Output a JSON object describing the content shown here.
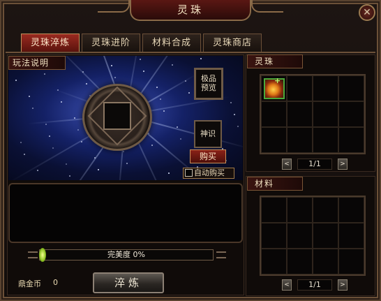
{
  "window": {
    "title": "灵珠",
    "close_label": "✕"
  },
  "tabs": [
    {
      "label": "灵珠淬炼",
      "active": true
    },
    {
      "label": "灵珠进阶",
      "active": false
    },
    {
      "label": "材料合成",
      "active": false
    },
    {
      "label": "灵珠商店",
      "active": false
    }
  ],
  "left": {
    "howto_label": "玩法说明",
    "premium_preview_line1": "极品",
    "premium_preview_line2": "预览",
    "shenshi_label": "神识",
    "buy_label": "购买",
    "autobuy_label": "自动购买",
    "autobuy_checked": false,
    "progress_text": "完美度 0%",
    "progress_value": 0,
    "gold_label": "鼎金币",
    "gold_value": "0",
    "refine_label": "淬炼"
  },
  "right": {
    "orb_label": "灵珠",
    "orb_items": [
      {
        "slot": 0,
        "icon": "fire-orb-icon",
        "badge": "+"
      }
    ],
    "orb_pager": {
      "text": "1/1",
      "prev": "<",
      "next": ">"
    },
    "material_label": "材料",
    "material_pager": {
      "text": "1/1",
      "prev": "<",
      "next": ">"
    }
  },
  "colors": {
    "accent_red": "#8a2218",
    "frame_bronze": "#8a6a48",
    "item_border_green": "#4ca83a"
  }
}
